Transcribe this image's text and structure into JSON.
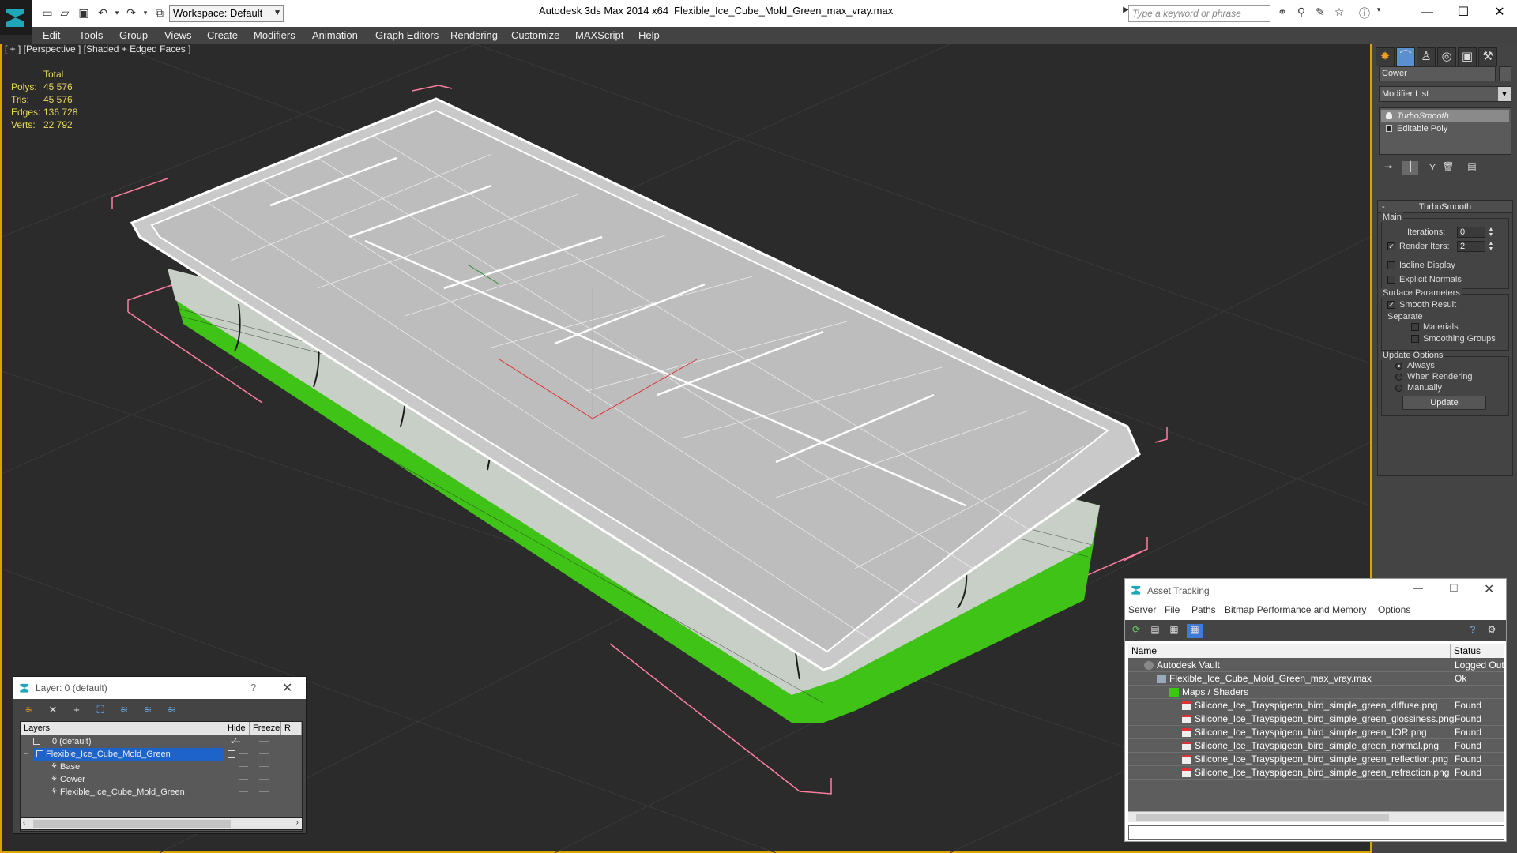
{
  "titlebar": {
    "workspace": "Workspace: Default",
    "app_title": "Autodesk 3ds Max  2014 x64",
    "file_title": "Flexible_Ice_Cube_Mold_Green_max_vray.max",
    "search_placeholder": "Type a keyword or phrase"
  },
  "menu": [
    "Edit",
    "Tools",
    "Group",
    "Views",
    "Create",
    "Modifiers",
    "Animation",
    "Graph Editors",
    "Rendering",
    "Customize",
    "MAXScript",
    "Help"
  ],
  "viewport": {
    "label": "[ + ] [Perspective ] [Shaded + Edged Faces ]",
    "stats": {
      "header": "Total",
      "rows": [
        {
          "label": "Polys:",
          "value": "45 576"
        },
        {
          "label": "Tris:",
          "value": "45 576"
        },
        {
          "label": "Edges:",
          "value": "136 728"
        },
        {
          "label": "Verts:",
          "value": "22 792"
        }
      ]
    }
  },
  "command_panel": {
    "object_name": "Cower",
    "modifier_list": "Modifier List",
    "stack": [
      "TurboSmooth",
      "Editable Poly"
    ],
    "rollout_title": "TurboSmooth",
    "main_group": "Main",
    "iterations_label": "Iterations:",
    "iterations_value": "0",
    "render_iters_label": "Render Iters:",
    "render_iters_value": "2",
    "isoline_label": "Isoline Display",
    "explicit_label": "Explicit Normals",
    "surface_group": "Surface Parameters",
    "smooth_result_label": "Smooth Result",
    "separate_label": "Separate",
    "materials_label": "Materials",
    "smoothing_groups_label": "Smoothing Groups",
    "update_group": "Update Options",
    "always_label": "Always",
    "when_rendering_label": "When Rendering",
    "manually_label": "Manually",
    "update_button": "Update"
  },
  "layer_dialog": {
    "title": "Layer: 0 (default)",
    "help": "?",
    "columns": [
      "Layers",
      "Hide",
      "Freeze",
      "R"
    ],
    "rows": [
      {
        "name": "0 (default)"
      },
      {
        "name": "Flexible_Ice_Cube_Mold_Green"
      },
      {
        "name": "Base"
      },
      {
        "name": "Cower"
      },
      {
        "name": "Flexible_Ice_Cube_Mold_Green"
      }
    ]
  },
  "asset_dialog": {
    "title": "Asset Tracking",
    "menu": [
      "Server",
      "File",
      "Paths",
      "Bitmap Performance and Memory",
      "Options"
    ],
    "columns": [
      "Name",
      "Status"
    ],
    "rows": [
      {
        "name": "Autodesk Vault",
        "status": "Logged Out"
      },
      {
        "name": "Flexible_Ice_Cube_Mold_Green_max_vray.max",
        "status": "Ok"
      },
      {
        "name": "Maps / Shaders",
        "status": ""
      },
      {
        "name": "Silicone_Ice_Trayspigeon_bird_simple_green_diffuse.png",
        "status": "Found"
      },
      {
        "name": "Silicone_Ice_Trayspigeon_bird_simple_green_glossiness.png",
        "status": "Found"
      },
      {
        "name": "Silicone_Ice_Trayspigeon_bird_simple_green_IOR.png",
        "status": "Found"
      },
      {
        "name": "Silicone_Ice_Trayspigeon_bird_simple_green_normal.png",
        "status": "Found"
      },
      {
        "name": "Silicone_Ice_Trayspigeon_bird_simple_green_reflection.png",
        "status": "Found"
      },
      {
        "name": "Silicone_Ice_Trayspigeon_bird_simple_green_refraction.png",
        "status": "Found"
      }
    ]
  },
  "colors": {
    "viewport_bg": "#2b2b2b",
    "mold_green": "#3fc317",
    "stats_yellow": "#e8d85a",
    "selection_blue": "#1e63c9",
    "active_border": "#d8a400"
  }
}
